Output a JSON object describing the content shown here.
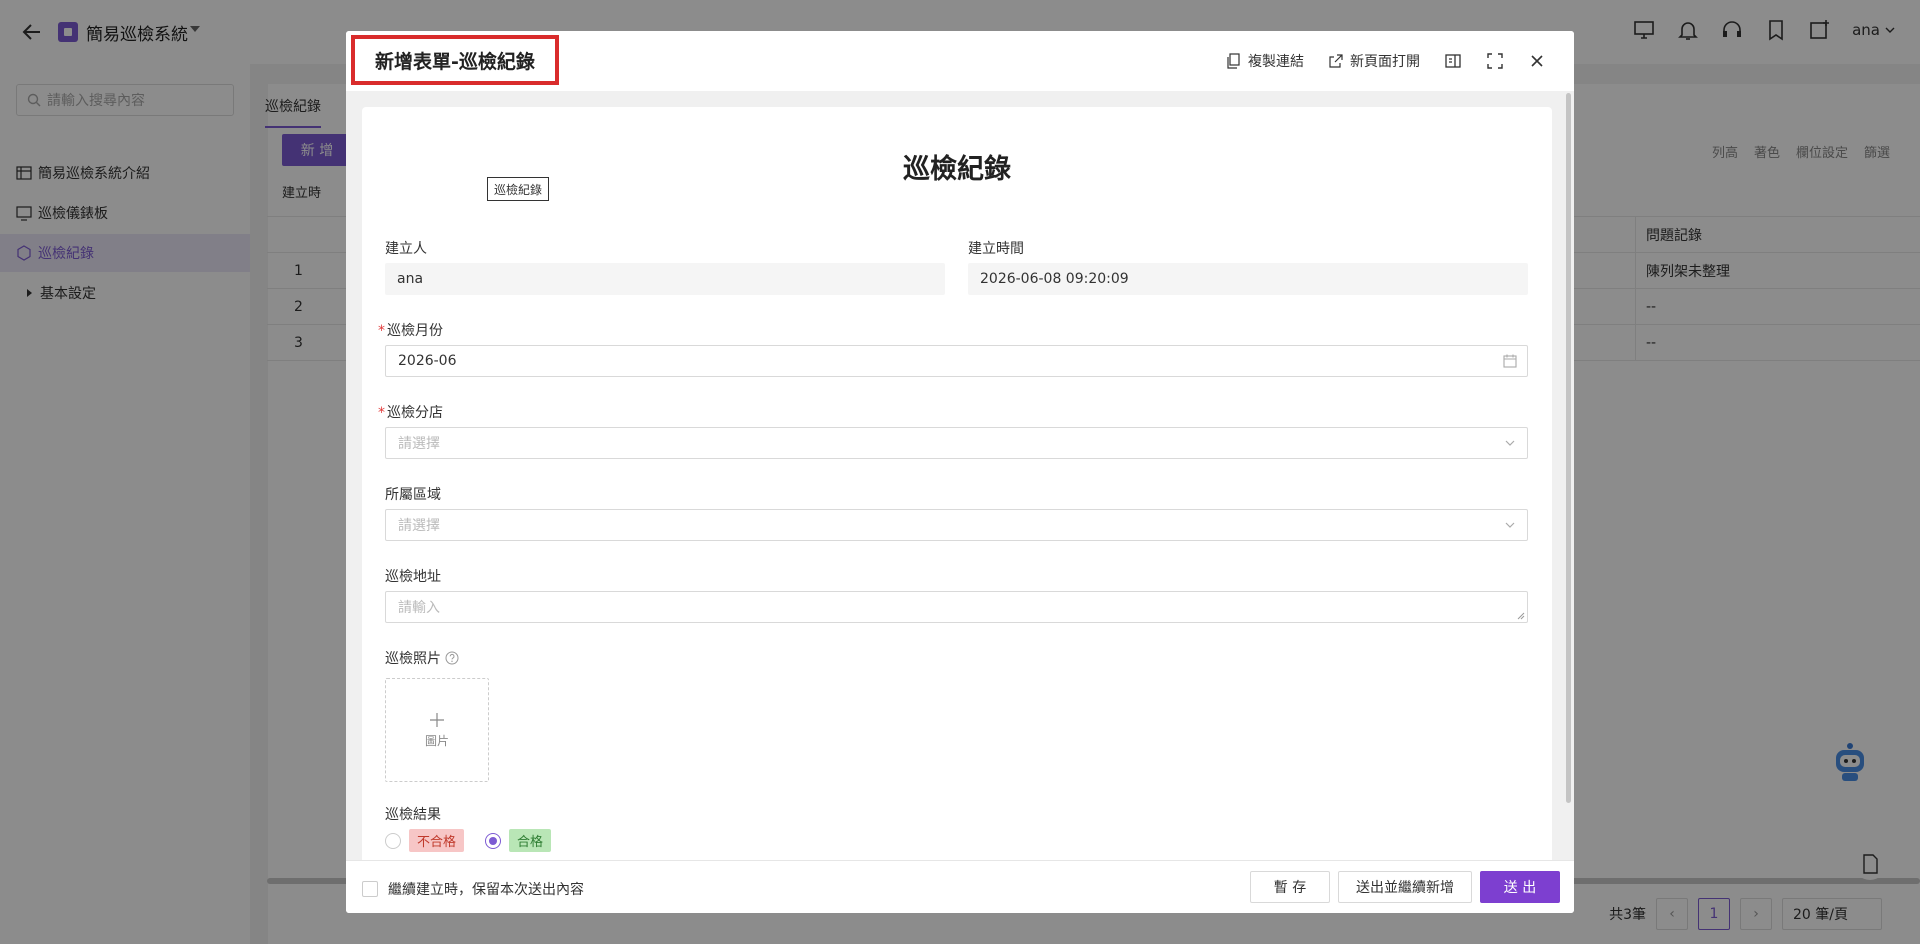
{
  "app": {
    "title": "簡易巡檢系統",
    "user": "ana"
  },
  "sidebar": {
    "search_placeholder": "請輸入搜尋內容",
    "items": [
      {
        "label": "簡易巡檢系統介紹"
      },
      {
        "label": "巡檢儀錶板"
      },
      {
        "label": "巡檢紀錄"
      },
      {
        "label": "基本設定"
      }
    ]
  },
  "main": {
    "tab": "巡檢紀錄",
    "new_button": "新 增",
    "tools": [
      "列高",
      "著色",
      "欄位設定",
      "篩選"
    ],
    "filter_chip": "建立時",
    "column_header": "問題記錄",
    "rows": [
      {
        "no": "1",
        "issue": "陳列架未整理"
      },
      {
        "no": "2",
        "issue": "--"
      },
      {
        "no": "3",
        "issue": "--"
      }
    ],
    "pager": {
      "total": "共3筆",
      "current": "1",
      "page_size": "20 筆/頁"
    }
  },
  "modal": {
    "title": "新增表單-巡檢紀錄",
    "actions": {
      "copy_link": "複製連結",
      "open_new_page": "新頁面打開"
    },
    "form": {
      "heading": "巡檢紀錄",
      "tag": "巡檢紀錄",
      "creator": {
        "label": "建立人",
        "value": "ana"
      },
      "created_time": {
        "label": "建立時間",
        "value": "2026-06-08 09:20:09"
      },
      "month": {
        "label": "巡檢月份",
        "value": "2026-06"
      },
      "branch": {
        "label": "巡檢分店",
        "placeholder": "請選擇"
      },
      "area": {
        "label": "所屬區域",
        "placeholder": "請選擇"
      },
      "address": {
        "label": "巡檢地址",
        "placeholder": "請輸入"
      },
      "photo": {
        "label": "巡檢照片",
        "upload_label": "圖片"
      },
      "result": {
        "label": "巡檢結果",
        "options": [
          "不合格",
          "合格"
        ],
        "selected": "合格"
      }
    },
    "footer": {
      "keep_label": "繼續建立時，保留本次送出內容",
      "save_draft": "暫 存",
      "submit_and_new": "送出並繼續新增",
      "submit": "送 出"
    }
  },
  "colors": {
    "accent": "#7d5bd3",
    "highlight_border": "#d92c2c",
    "fail_tag_bg": "#f7c6c6",
    "pass_tag_bg": "#b9e6b6"
  }
}
